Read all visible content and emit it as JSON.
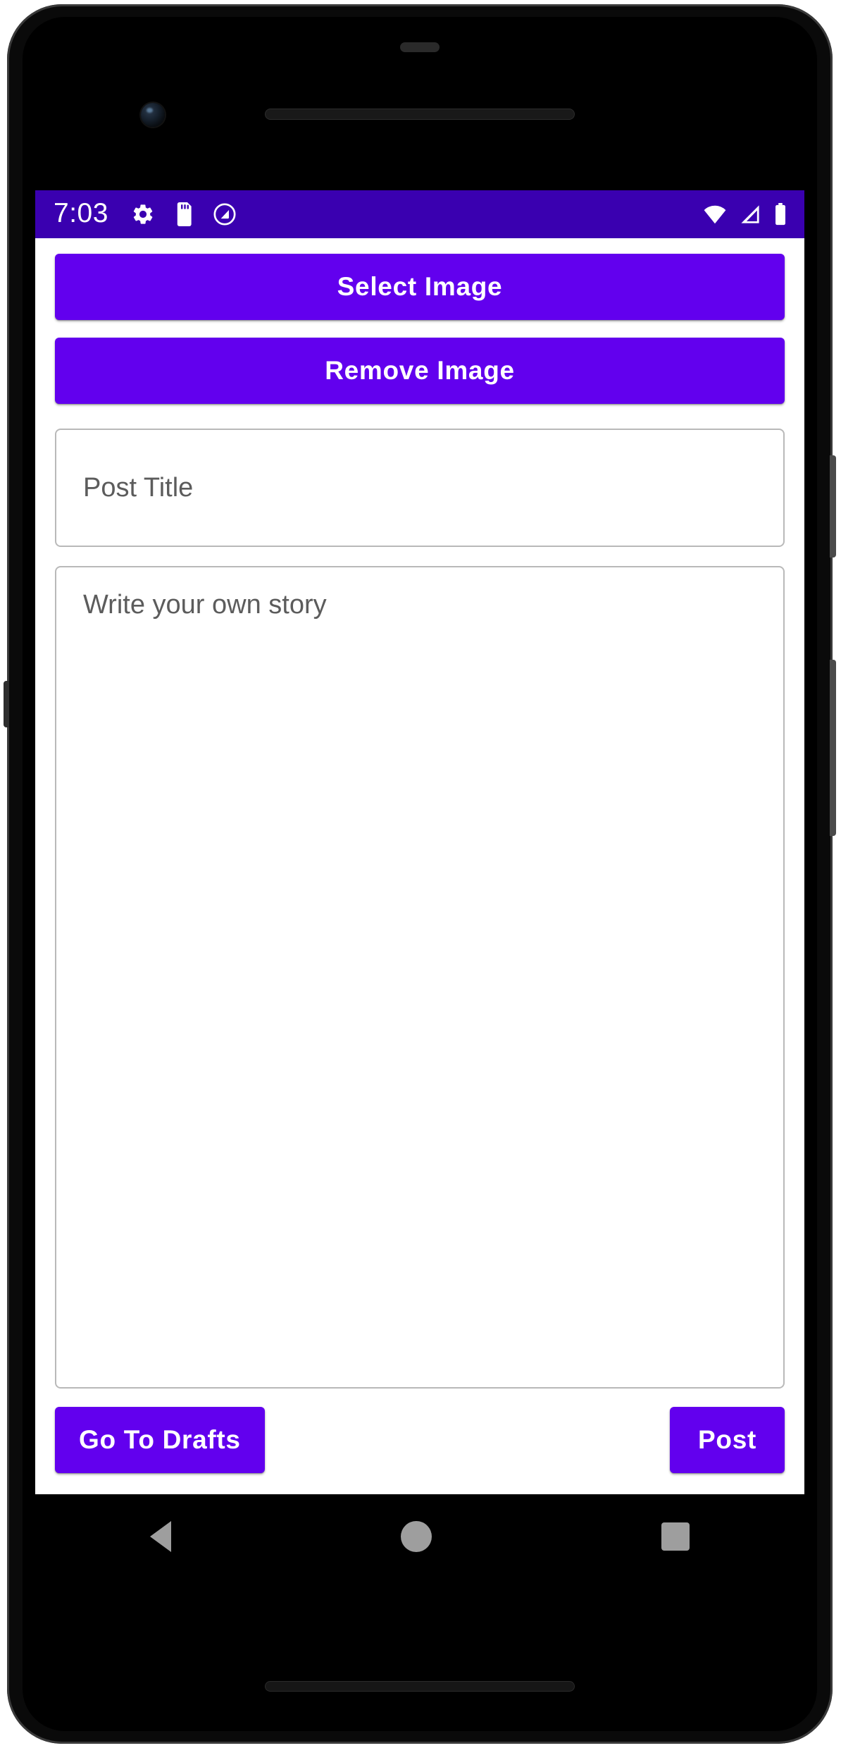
{
  "device": {
    "frame_label": "android-phone-mockup",
    "bezel_color": "#0a0a0a",
    "screen_color": "#000000"
  },
  "status_bar": {
    "clock": "7:03",
    "background_color": "#3A00B0",
    "foreground_color": "#FFFFFF",
    "left_icons": [
      {
        "name": "settings-gear-icon",
        "label": "Settings"
      },
      {
        "name": "sd-card-icon",
        "label": "SD Card"
      },
      {
        "name": "do-not-disturb-icon",
        "label": "Do Not Disturb"
      }
    ],
    "right_icons": [
      {
        "name": "wifi-icon",
        "label": "Wi-Fi"
      },
      {
        "name": "cellular-signal-icon",
        "label": "Mobile Signal"
      },
      {
        "name": "battery-icon",
        "label": "Battery Full"
      }
    ]
  },
  "app": {
    "accent_color": "#6200EE",
    "background_color": "#FFFFFF",
    "select_image_label": "Select Image",
    "remove_image_label": "Remove Image",
    "title_field": {
      "placeholder": "Post Title",
      "value": ""
    },
    "story_field": {
      "placeholder": "Write your own story",
      "value": ""
    },
    "go_to_drafts_label": "Go To Drafts",
    "post_label": "Post"
  },
  "nav_bar": {
    "background_color": "#000000",
    "icon_color": "#9E9E9E",
    "keys": [
      {
        "name": "back-icon",
        "label": "Back"
      },
      {
        "name": "home-icon",
        "label": "Home"
      },
      {
        "name": "recents-icon",
        "label": "Recent Apps"
      }
    ]
  }
}
